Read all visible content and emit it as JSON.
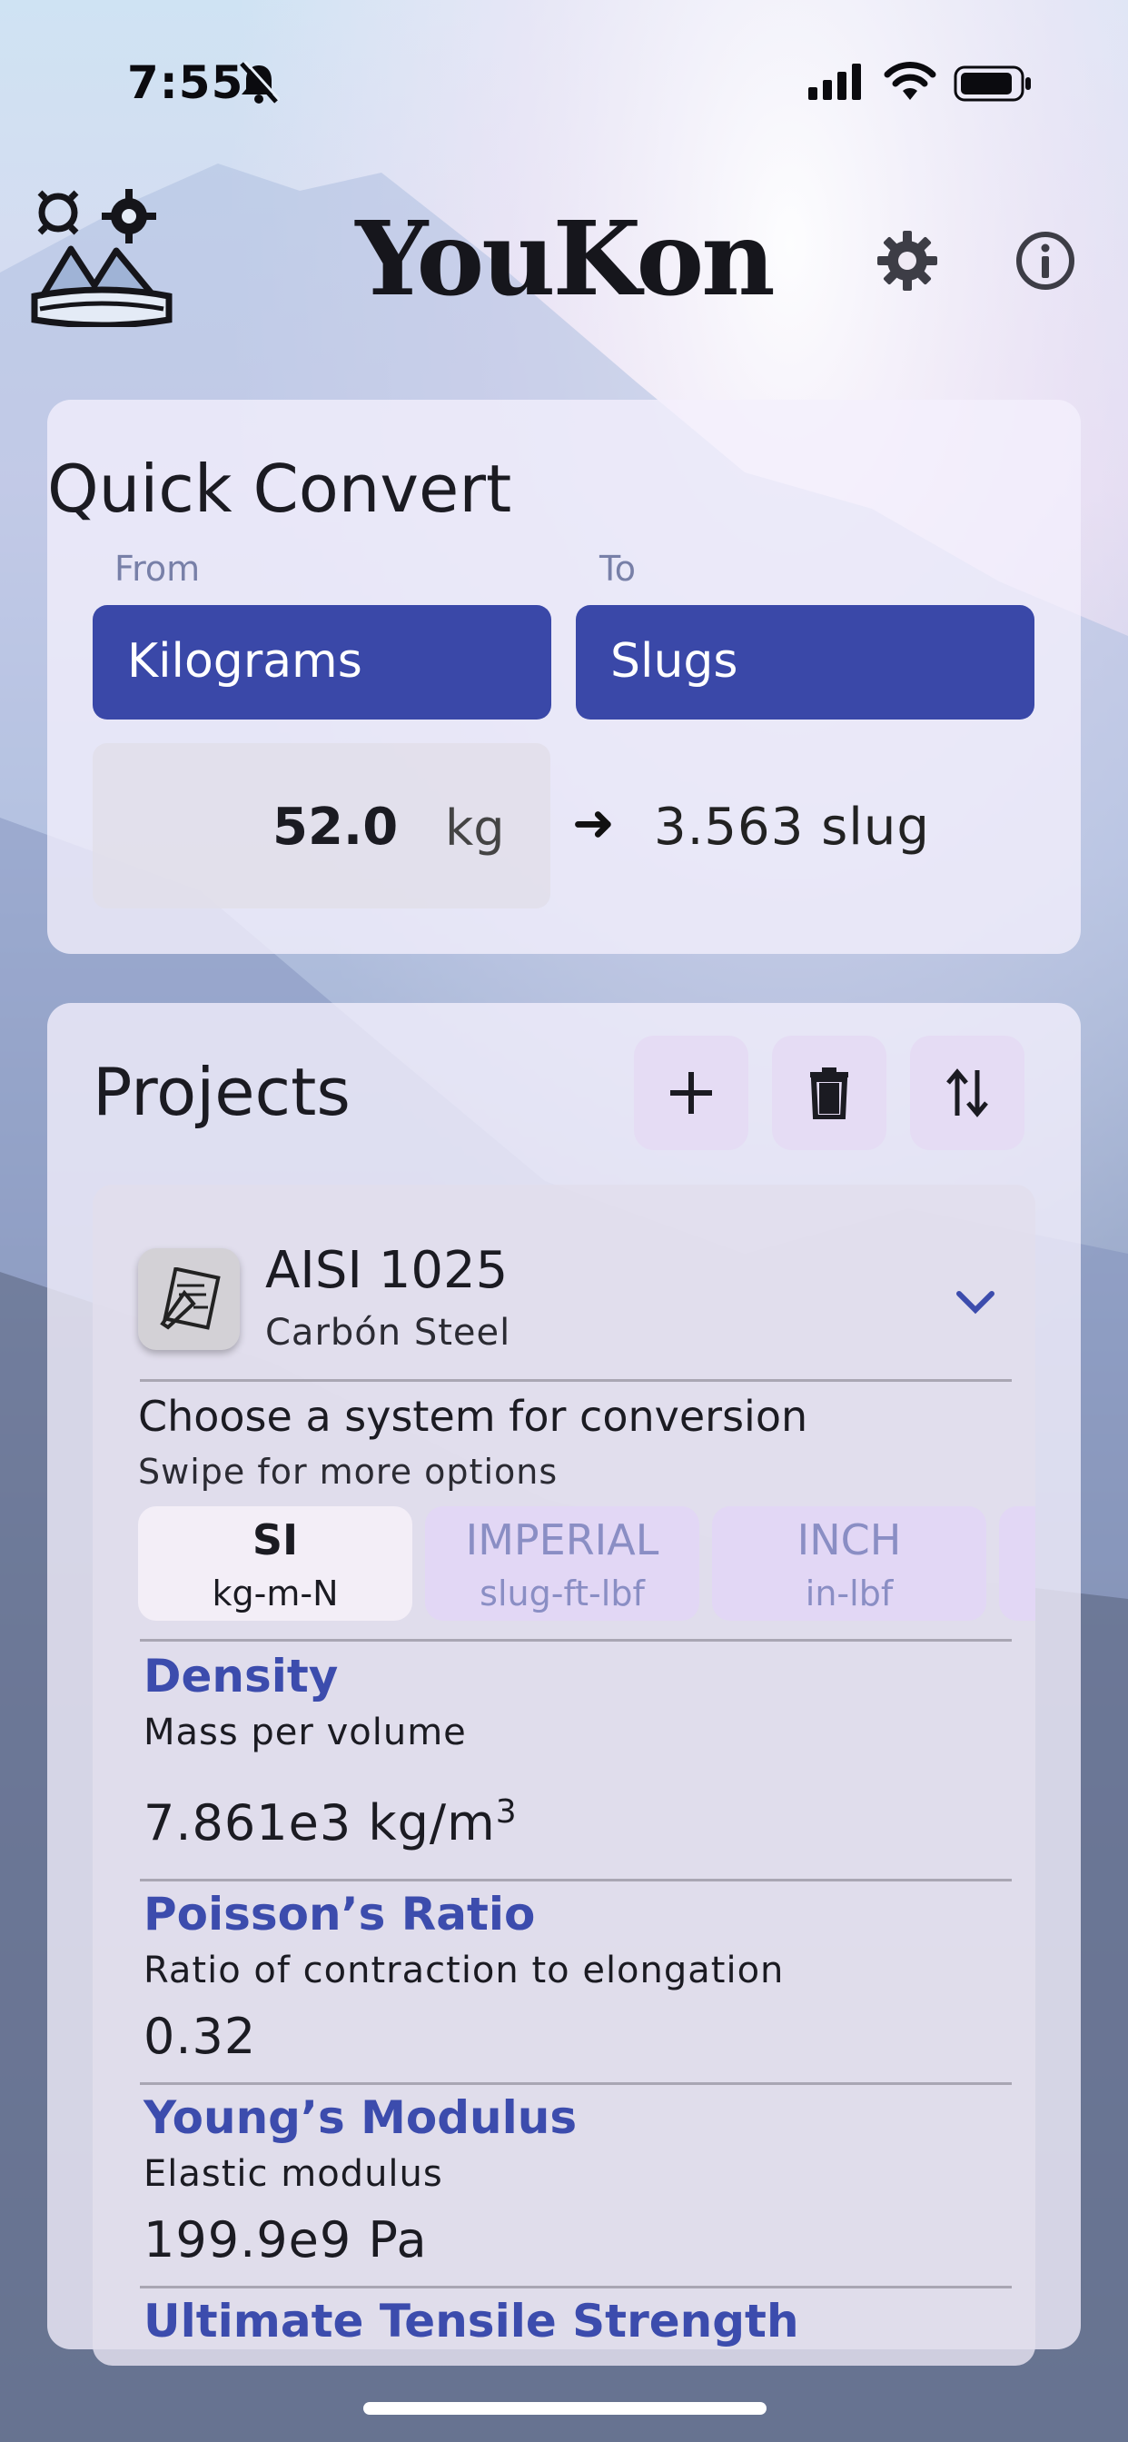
{
  "status_bar": {
    "time": "7:55"
  },
  "header": {
    "title": "YouKon"
  },
  "quick_convert": {
    "title": "Quick Convert",
    "from_label": "From",
    "to_label": "To",
    "from_unit": "Kilograms",
    "to_unit": "Slugs",
    "input_value": "52.0",
    "input_unit": "kg",
    "arrow": "➜",
    "result": "3.563 slug"
  },
  "projects": {
    "title": "Projects",
    "project": {
      "name": "AISI 1025",
      "material": "Carbón Steel",
      "choose_text": "Choose a system for conversion",
      "swipe_text": "Swipe for more options",
      "systems": [
        {
          "name": "SI",
          "units": "kg-m-N"
        },
        {
          "name": "IMPERIAL",
          "units": "slug-ft-lbf"
        },
        {
          "name": "INCH",
          "units": "in-lbf"
        }
      ],
      "properties": [
        {
          "name": "Density",
          "description": "Mass per volume",
          "value": "7.861e3 kg/m",
          "exp": "3"
        },
        {
          "name": "Poisson’s Ratio",
          "description": "Ratio of contraction to elongation",
          "value": "0.32"
        },
        {
          "name": "Young’s Modulus",
          "description": "Elastic modulus",
          "value": "199.9e9 Pa"
        },
        {
          "name": "Ultimate Tensile Strength"
        }
      ]
    }
  }
}
